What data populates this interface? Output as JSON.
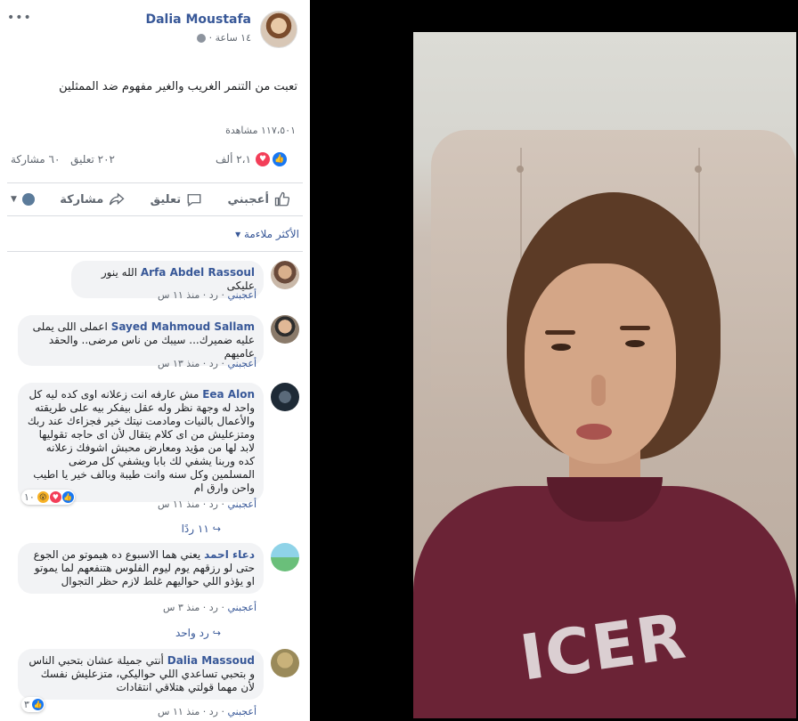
{
  "post": {
    "author": "Dalia Moustafa",
    "time": "١٤ ساعة ·",
    "text": "تعبت من التنمر الغريب والغير مفهوم ضد الممثلين",
    "views": "١١٧،٥٠١ مشاهدة",
    "reactions_count": "٢،١ ألف",
    "comments_count": "٢٠٢ تعليق",
    "shares_count": "٦٠ مشاركة",
    "more": "•••"
  },
  "actions": {
    "like": "أعجبني",
    "comment": "تعليق",
    "share": "مشاركة"
  },
  "sort": {
    "label": "الأكثر ملاءمة ▾"
  },
  "comments": [
    {
      "name": "Arfa Abdel Rassoul",
      "text": "الله ينور عليكى",
      "meta_like": "أعجبني",
      "meta_rest": " · رد · منذ ١١ س"
    },
    {
      "name": "Sayed Mahmoud Sallam",
      "text": "اعملى اللى يملى عليه ضميرك... سيبك من ناس مرضى.. والحقد عاميهم",
      "meta_like": "أعجبني",
      "meta_rest": " · رد · منذ ١٣ س"
    },
    {
      "name": "Eea Alon",
      "text": "مش عارفه انت زعلانه اوى كده ليه كل واحد له وجهة نظر وله عقل بيفكر بيه على طريقته والأعمال بالنيات ومادمت نيتك خير فجزاءك عند ربك ومتزعليش من اى كلام يتقال لأن اى حاجه تقوليها لابد لها من مؤيد ومعارض محبش اشوفك زعلانه كده وربنا يشفي لك بابا ويشفي كل مرضى المسلمين وكل سنه وانت طيبة وبالف خير يا اطيب واحن وارق ام",
      "meta_like": "أعجبني",
      "meta_rest": " · رد · منذ ١١ س",
      "reactions": "١٠",
      "replies": "١١ ردًا"
    },
    {
      "name": "دعاء احمد",
      "text": "يعني هما الاسبوع ده هيموتو من الجوع حتى لو رزقهم يوم ليوم الفلوس هتنفعهم لما يموتو او يؤذو اللي حواليهم غلط لازم حظر التجوال",
      "meta_like": "أعجبني",
      "meta_rest": " · رد · منذ ٣ س",
      "replies": "رد واحد"
    },
    {
      "name": "Dalia Massoud",
      "text": "أنتي جميلة عشان بتحبي الناس و بتحبي تساعدي اللي حواليكي، متزعليش نفسك لأن مهما قولتي هتلاقي انتقادات",
      "meta_like": "أعجبني",
      "meta_rest": " · رد · منذ ١١ س",
      "reactions": "٣"
    }
  ],
  "video": {
    "shirt_print": "ICER"
  },
  "colors": {
    "link": "#385898",
    "like": "#1877f2",
    "love": "#f33e58",
    "sweater": "#6b2336"
  }
}
